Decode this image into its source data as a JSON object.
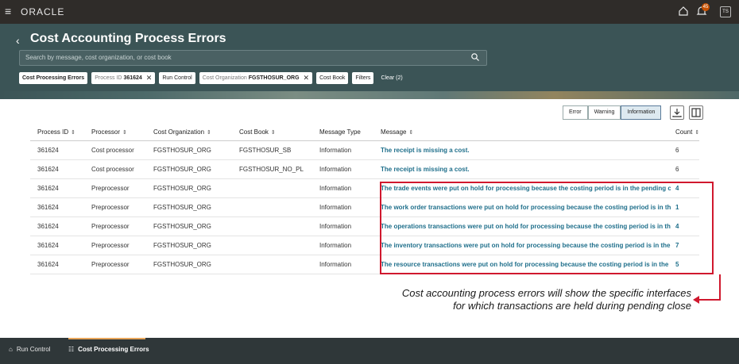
{
  "topbar": {
    "logo": "ORACLE",
    "notification_count": "45",
    "user_initials": "TS",
    "icons": [
      "hamburger-menu-icon",
      "home-icon",
      "bell-icon"
    ]
  },
  "header": {
    "title": "Cost Accounting Process Errors",
    "search_placeholder": "Search by message, cost organization, or cost book",
    "chips": {
      "chip1": "Cost Processing Errors",
      "process_id_label": "Process ID",
      "process_id_value": "361624",
      "run_control": "Run Control",
      "cost_org_label": "Cost Organization",
      "cost_org_value": "FGSTHOSUR_ORG",
      "cost_book": "Cost Book",
      "filters": "Filters",
      "clear": "Clear (2)"
    }
  },
  "toolbar": {
    "error": "Error",
    "warning": "Warning",
    "information": "Information",
    "active": "Information"
  },
  "table": {
    "headers": {
      "process_id": "Process ID",
      "processor": "Processor",
      "cost_org": "Cost Organization",
      "cost_book": "Cost Book",
      "message_type": "Message Type",
      "message": "Message",
      "count": "Count"
    },
    "rows": [
      {
        "process_id": "361624",
        "processor": "Cost processor",
        "cost_org": "FGSTHOSUR_ORG",
        "cost_book": "FGSTHOSUR_SB",
        "message_type": "Information",
        "message": "The receipt is missing a cost.",
        "count": "6"
      },
      {
        "process_id": "361624",
        "processor": "Cost processor",
        "cost_org": "FGSTHOSUR_ORG",
        "cost_book": "FGSTHOSUR_NO_PL",
        "message_type": "Information",
        "message": "The receipt is missing a cost.",
        "count": "6"
      },
      {
        "process_id": "361624",
        "processor": "Preprocessor",
        "cost_org": "FGSTHOSUR_ORG",
        "cost_book": "",
        "message_type": "Information",
        "message": "The trade events were put on hold for processing because the costing period is in the pending cl",
        "count": "4"
      },
      {
        "process_id": "361624",
        "processor": "Preprocessor",
        "cost_org": "FGSTHOSUR_ORG",
        "cost_book": "",
        "message_type": "Information",
        "message": "The work order transactions were put on hold for processing because the costing period is in the",
        "count": "1"
      },
      {
        "process_id": "361624",
        "processor": "Preprocessor",
        "cost_org": "FGSTHOSUR_ORG",
        "cost_book": "",
        "message_type": "Information",
        "message": "The operations transactions were put on hold for processing because the costing period is in the",
        "count": "4"
      },
      {
        "process_id": "361624",
        "processor": "Preprocessor",
        "cost_org": "FGSTHOSUR_ORG",
        "cost_book": "",
        "message_type": "Information",
        "message": "The inventory transactions were put on hold for processing because the costing period is in the p",
        "count": "7"
      },
      {
        "process_id": "361624",
        "processor": "Preprocessor",
        "cost_org": "FGSTHOSUR_ORG",
        "cost_book": "",
        "message_type": "Information",
        "message": "The resource transactions were put on hold for processing because the costing period is in the pe",
        "count": "5"
      }
    ]
  },
  "annotation": {
    "line1": "Cost accounting process errors will show the specific interfaces",
    "line2": "for which transactions are held during pending close",
    "color": "#d0182e"
  },
  "bottom_nav": {
    "run_control": "Run Control",
    "cost_processing_errors": "Cost Processing Errors"
  }
}
